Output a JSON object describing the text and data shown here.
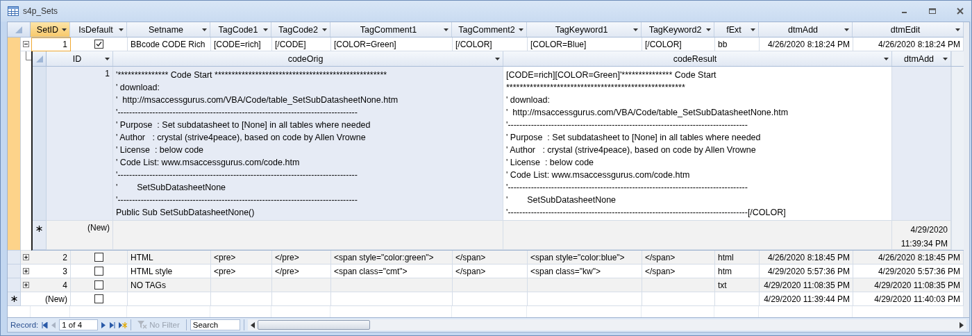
{
  "window": {
    "title": "s4p_Sets"
  },
  "table": {
    "columns": [
      {
        "label": "SetID",
        "selected": true
      },
      {
        "label": "IsDefault",
        "selected": false
      },
      {
        "label": "Setname",
        "selected": false
      },
      {
        "label": "TagCode1",
        "selected": false
      },
      {
        "label": "TagCode2",
        "selected": false
      },
      {
        "label": "TagComment1",
        "selected": false
      },
      {
        "label": "TagComment2",
        "selected": false
      },
      {
        "label": "TagKeyword1",
        "selected": false
      },
      {
        "label": "TagKeyword2",
        "selected": false
      },
      {
        "label": "fExt",
        "selected": false
      },
      {
        "label": "dtmAdd",
        "selected": false
      },
      {
        "label": "dtmEdit",
        "selected": false
      }
    ],
    "rows": [
      {
        "is_default": true,
        "expanded": true,
        "current": true,
        "cells": [
          "1",
          "",
          "BBcode CODE Rich",
          "[CODE=rich]",
          "[/CODE]",
          "[COLOR=Green]",
          "[/COLOR]",
          "[COLOR=Blue]",
          "[/COLOR]",
          "bb",
          "4/26/2020 8:18:24 PM",
          "4/26/2020 8:18:24 PM"
        ],
        "subdatasheet": {
          "columns": [
            {
              "label": "ID",
              "focused": false
            },
            {
              "label": "codeOrig",
              "focused": false
            },
            {
              "label": "codeResult",
              "focused": true
            },
            {
              "label": "dtmAdd",
              "focused": false
            }
          ],
          "rows": [
            {
              "selected": true,
              "cells": [
                "1",
                [
                  "'*************** Code Start ***************************************************",
                  "' download:",
                  "'  http://msaccessgurus.com/VBA/Code/table_SetSubDatasheetNone.htm",
                  "'-----------------------------------------------------------------------------------",
                  "' Purpose  : Set subdatasheet to [None] in all tables where needed",
                  "' Author   : crystal (strive4peace), based on code by Allen Vrowne",
                  "' License  : below code",
                  "' Code List: www.msaccessgurus.com/code.htm",
                  "'-----------------------------------------------------------------------------------",
                  "'        SetSubDatasheetNone",
                  "'-----------------------------------------------------------------------------------",
                  "Public Sub SetSubDatasheetNone()"
                ],
                [
                  "[CODE=rich][COLOR=Green]'*************** Code Start",
                  "*****************************************************",
                  "' download:",
                  "'  http://msaccessgurus.com/VBA/Code/table_SetSubDatasheetNone.htm",
                  "'-----------------------------------------------------------------------------------",
                  "' Purpose  : Set subdatasheet to [None] in all tables where needed",
                  "' Author   : crystal (strive4peace), based on code by Allen Vrowne",
                  "' License  : below code",
                  "' Code List: www.msaccessgurus.com/code.htm",
                  "'-----------------------------------------------------------------------------------",
                  "'        SetSubDatasheetNone",
                  "'-----------------------------------------------------------------------------------[/COLOR]"
                ],
                ""
              ]
            }
          ],
          "new_row": {
            "cells": [
              "(New)",
              "",
              "",
              "4/29/2020 11:39:34 PM"
            ]
          }
        }
      },
      {
        "is_default": false,
        "expanded": false,
        "current": false,
        "cells": [
          "2",
          "",
          "HTML",
          "<pre>",
          "</pre>",
          "<span style=\"color:green\">",
          "</span>",
          "<span style=\"color:blue\">",
          "</span>",
          "html",
          "4/26/2020 8:18:45 PM",
          "4/26/2020 8:18:45 PM"
        ]
      },
      {
        "is_default": false,
        "expanded": false,
        "current": false,
        "cells": [
          "3",
          "",
          "HTML style",
          "<pre>",
          "</pre>",
          "<span class=\"cmt\">",
          "</span>",
          "<span class=\"kw\">",
          "</span>",
          "htm",
          "4/29/2020 5:57:36 PM",
          "4/29/2020 5:57:36 PM"
        ]
      },
      {
        "is_default": false,
        "expanded": false,
        "current": false,
        "cells": [
          "4",
          "",
          "NO TAGs",
          "",
          "",
          "",
          "",
          "",
          "",
          "txt",
          "4/29/2020 11:08:35 PM",
          "4/29/2020 11:08:35 PM"
        ]
      }
    ],
    "new_row": {
      "is_default": false,
      "cells": [
        "(New)",
        "",
        "",
        "",
        "",
        "",
        "",
        "",
        "",
        "",
        "4/29/2020 11:39:44 PM",
        "4/29/2020 11:40:03 PM"
      ]
    }
  },
  "status_bar": {
    "label": "Record:",
    "position": "1 of 4",
    "filter": "No Filter",
    "filter_disabled": true,
    "search_placeholder": "Search"
  }
}
